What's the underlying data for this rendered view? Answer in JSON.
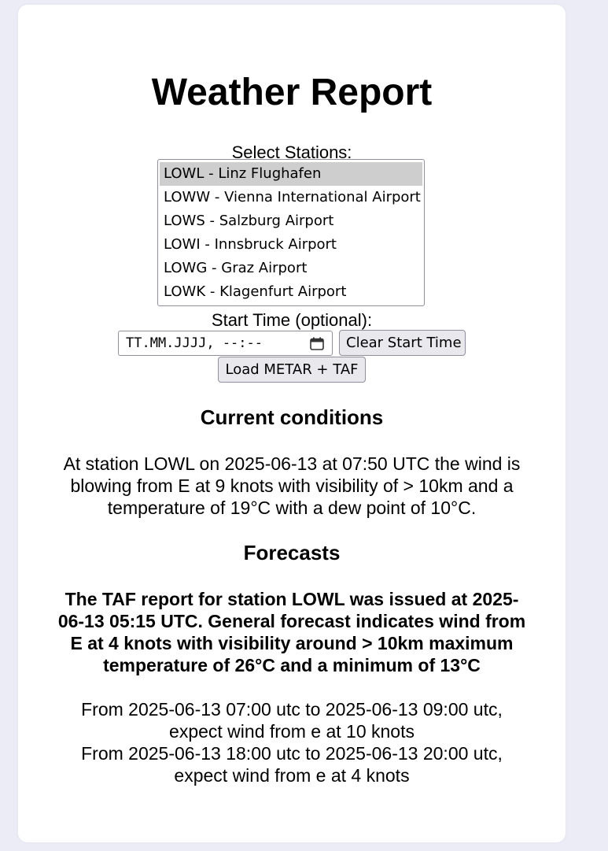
{
  "title": "Weather Report",
  "stations": {
    "label": "Select Stations:",
    "options": [
      {
        "code_name": "LOWL - Linz Flughafen",
        "selected": true
      },
      {
        "code_name": "LOWW - Vienna International Airport",
        "selected": false
      },
      {
        "code_name": "LOWS - Salzburg Airport",
        "selected": false
      },
      {
        "code_name": "LOWI - Innsbruck Airport",
        "selected": false
      },
      {
        "code_name": "LOWG - Graz Airport",
        "selected": false
      },
      {
        "code_name": "LOWK - Klagenfurt Airport",
        "selected": false
      }
    ]
  },
  "start_time": {
    "label": "Start Time (optional):",
    "placeholder": "TT.MM.JJJJ, --:--",
    "icon": "calendar-icon"
  },
  "buttons": {
    "clear_start_time": "Clear Start Time",
    "load": "Load METAR + TAF"
  },
  "current": {
    "heading": "Current conditions",
    "text": "At station LOWL on 2025-06-13 at 07:50 UTC the wind is blowing from E at 9 knots with visibility of > 10km and a temperature of 19°C with a dew point of 10°C."
  },
  "forecasts": {
    "heading": "Forecasts",
    "summary": "The TAF report for station LOWL was issued at 2025-06-13 05:15 UTC. General forecast indicates wind from E at 4 knots with visibility around > 10km maximum temperature of 26°C and a minimum of 13°C",
    "periods": [
      "From 2025-06-13 07:00 utc to 2025-06-13 09:00 utc, expect wind from e at 10 knots",
      "From 2025-06-13 18:00 utc to 2025-06-13 20:00 utc, expect wind from e at 4 knots"
    ]
  },
  "colors": {
    "background": "#ececf7",
    "card": "#ffffff",
    "selected_option": "#cecece",
    "button": "#e9e9ed"
  }
}
